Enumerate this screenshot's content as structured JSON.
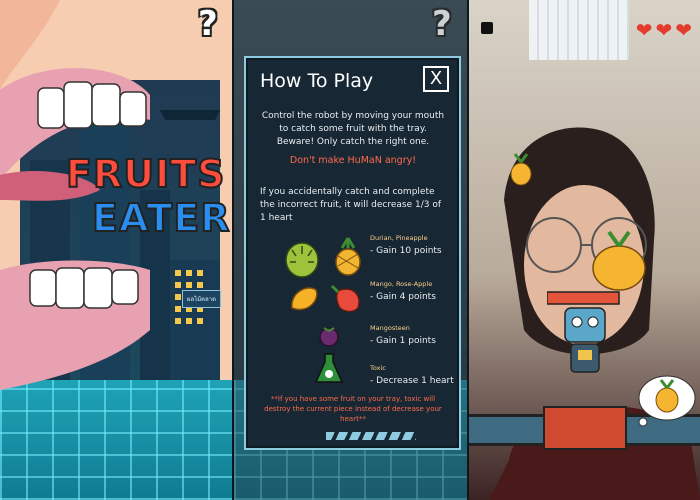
{
  "screen1": {
    "title_line1": "FRUITS",
    "title_line2": "EATER",
    "help_icon": "?",
    "sign_text": "ผลไม้ตลาด"
  },
  "screen2": {
    "help_icon": "?",
    "modal": {
      "title": "How To Play",
      "close_icon": "X",
      "intro": "Control the robot by moving your mouth to catch some fruit with the tray.",
      "beware": "Beware! Only catch the right one.",
      "warning": "Don't make HuMaN angry!",
      "incorrect_note": "If you accidentally catch and complete the incorrect fruit, it will decrease 1/3 of 1 heart",
      "fruit_rows": [
        {
          "label": "Durian, Pineapple",
          "value": "- Gain 10 points"
        },
        {
          "label": "Mango, Rose-Apple",
          "value": "- Gain 4 points"
        },
        {
          "label": "Mangosteen",
          "value": "- Gain 1 points"
        },
        {
          "label": "Toxic",
          "value": "- Decrease 1 heart"
        }
      ],
      "footnote": "**If you have some fruit on your tray, toxic will destroy the current piece instead of decrease your heart**"
    }
  },
  "screen3": {
    "hearts": [
      "heart",
      "heart",
      "heart"
    ],
    "pause_icon": "pause-icon"
  },
  "colors": {
    "title_red": "#ff4d3d",
    "title_blue": "#2a8ef0",
    "warning": "#ff6a4b",
    "grid_cyan": "#1fa3b6",
    "heart": "#e43b2f"
  }
}
